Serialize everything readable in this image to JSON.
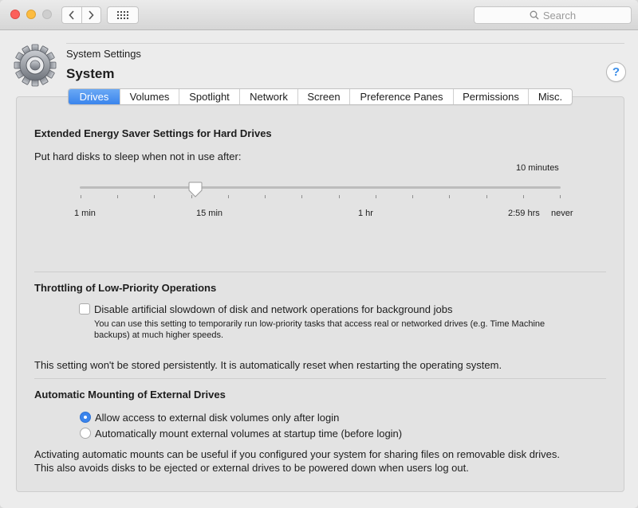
{
  "toolbar": {
    "search_placeholder": "Search",
    "icons": [
      "back-chevron-icon",
      "forward-chevron-icon",
      "app-grid-icon",
      "search-icon"
    ]
  },
  "header": {
    "breadcrumb": "System Settings",
    "title": "System",
    "help_label": "?"
  },
  "tabs": [
    {
      "label": "Drives",
      "active": true
    },
    {
      "label": "Volumes",
      "active": false
    },
    {
      "label": "Spotlight",
      "active": false
    },
    {
      "label": "Network",
      "active": false
    },
    {
      "label": "Screen",
      "active": false
    },
    {
      "label": "Preference Panes",
      "active": false
    },
    {
      "label": "Permissions",
      "active": false
    },
    {
      "label": "Misc.",
      "active": false
    }
  ],
  "energy": {
    "heading": "Extended Energy Saver Settings for Hard Drives",
    "prompt": "Put hard disks to sleep when not in use after:",
    "current_value": "10 minutes",
    "slider_fraction": 0.2,
    "tick_count": 14,
    "scale_labels": [
      "1 min",
      "15 min",
      "1 hr",
      "2:59 hrs",
      "never"
    ]
  },
  "throttling": {
    "heading": "Throttling of Low-Priority Operations",
    "checkbox_label": "Disable artificial slowdown of disk and network operations for background jobs",
    "checkbox_checked": false,
    "help_line1": "You can use this setting to temporarily run low-priority tasks that access real or networked drives (e.g. Time Machine",
    "help_line2": "backups) at much higher speeds.",
    "note": "This setting won't be stored persistently. It is automatically reset when restarting the operating system."
  },
  "mounting": {
    "heading": "Automatic Mounting of External Drives",
    "options": [
      {
        "label": "Allow access to external disk volumes only after login",
        "selected": true
      },
      {
        "label": "Automatically mount external volumes at startup time (before login)",
        "selected": false
      }
    ],
    "note_line1": "Activating automatic mounts can be useful if you configured your system for sharing files on removable disk drives.",
    "note_line2": "This also avoids disks to be ejected or external drives to be powered down when users log out."
  },
  "colors": {
    "accent": "#3a84ec",
    "close": "#fc605b",
    "minimize": "#fdbc40"
  }
}
